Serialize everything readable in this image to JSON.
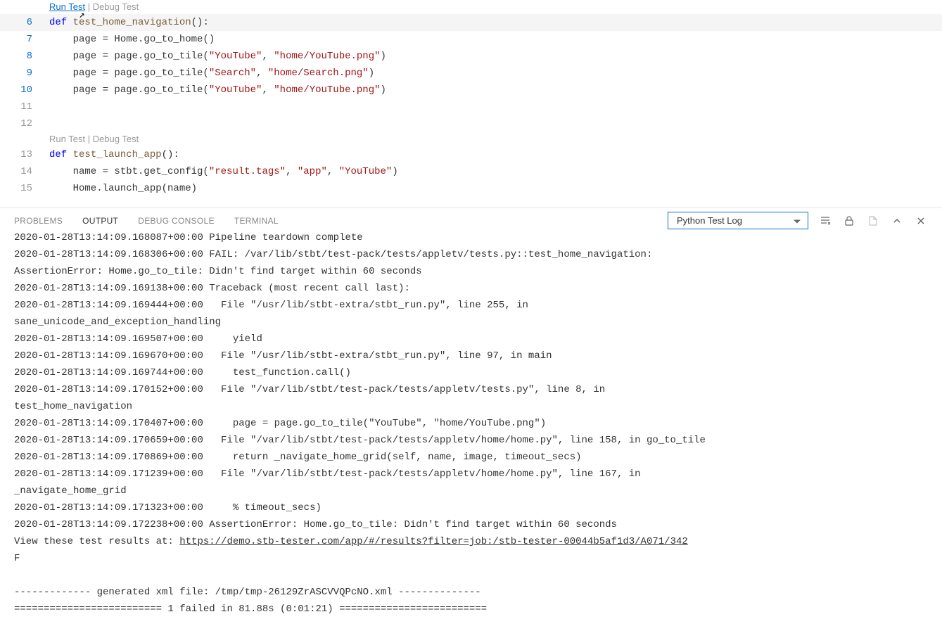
{
  "editor": {
    "codelens1": {
      "run": "Run Test",
      "debug": "Debug Test"
    },
    "codelens2": {
      "run": "Run Test",
      "debug": "Debug Test"
    },
    "lines": [
      {
        "num": "6",
        "active": true,
        "highlighted": true,
        "tokens": [
          {
            "t": "def ",
            "c": "kw"
          },
          {
            "t": "test_home_navigation",
            "c": "fn"
          },
          {
            "t": "():",
            "c": ""
          }
        ]
      },
      {
        "num": "7",
        "active": true,
        "tokens": [
          {
            "t": "    page = Home.go_to_home()",
            "c": ""
          }
        ]
      },
      {
        "num": "8",
        "active": true,
        "tokens": [
          {
            "t": "    page = page.go_to_tile(",
            "c": ""
          },
          {
            "t": "\"YouTube\"",
            "c": "str"
          },
          {
            "t": ", ",
            "c": ""
          },
          {
            "t": "\"home/YouTube.png\"",
            "c": "str"
          },
          {
            "t": ")",
            "c": ""
          }
        ]
      },
      {
        "num": "9",
        "active": true,
        "tokens": [
          {
            "t": "    page = page.go_to_tile(",
            "c": ""
          },
          {
            "t": "\"Search\"",
            "c": "str"
          },
          {
            "t": ", ",
            "c": ""
          },
          {
            "t": "\"home/Search.png\"",
            "c": "str"
          },
          {
            "t": ")",
            "c": ""
          }
        ]
      },
      {
        "num": "10",
        "active": true,
        "tokens": [
          {
            "t": "    page = page.go_to_tile(",
            "c": ""
          },
          {
            "t": "\"YouTube\"",
            "c": "str"
          },
          {
            "t": ", ",
            "c": ""
          },
          {
            "t": "\"home/YouTube.png\"",
            "c": "str"
          },
          {
            "t": ")",
            "c": ""
          }
        ]
      },
      {
        "num": "11",
        "tokens": []
      },
      {
        "num": "12",
        "tokens": []
      },
      {
        "num": "13",
        "tokens": [
          {
            "t": "def ",
            "c": "kw"
          },
          {
            "t": "test_launch_app",
            "c": "fn"
          },
          {
            "t": "():",
            "c": ""
          }
        ]
      },
      {
        "num": "14",
        "tokens": [
          {
            "t": "    name = stbt.get_config(",
            "c": ""
          },
          {
            "t": "\"result.tags\"",
            "c": "str"
          },
          {
            "t": ", ",
            "c": ""
          },
          {
            "t": "\"app\"",
            "c": "str"
          },
          {
            "t": ", ",
            "c": ""
          },
          {
            "t": "\"YouTube\"",
            "c": "str"
          },
          {
            "t": ")",
            "c": ""
          }
        ]
      },
      {
        "num": "15",
        "tokens": [
          {
            "t": "    Home.launch_app(name)",
            "c": ""
          }
        ]
      }
    ]
  },
  "panel": {
    "tabs": {
      "problems": "PROBLEMS",
      "output": "OUTPUT",
      "debug": "DEBUG CONSOLE",
      "terminal": "TERMINAL"
    },
    "select": "Python Test Log",
    "output_lines": [
      "2020-01-28T13:14:09.168087+00:00 Pipeline teardown complete",
      "2020-01-28T13:14:09.168306+00:00 FAIL: /var/lib/stbt/test-pack/tests/appletv/tests.py::test_home_navigation: ",
      "AssertionError: Home.go_to_tile: Didn't find target within 60 seconds",
      "2020-01-28T13:14:09.169138+00:00 Traceback (most recent call last):",
      "2020-01-28T13:14:09.169444+00:00   File \"/usr/lib/stbt-extra/stbt_run.py\", line 255, in ",
      "sane_unicode_and_exception_handling",
      "2020-01-28T13:14:09.169507+00:00     yield",
      "2020-01-28T13:14:09.169670+00:00   File \"/usr/lib/stbt-extra/stbt_run.py\", line 97, in main",
      "2020-01-28T13:14:09.169744+00:00     test_function.call()",
      "2020-01-28T13:14:09.170152+00:00   File \"/var/lib/stbt/test-pack/tests/appletv/tests.py\", line 8, in ",
      "test_home_navigation",
      "2020-01-28T13:14:09.170407+00:00     page = page.go_to_tile(\"YouTube\", \"home/YouTube.png\")",
      "2020-01-28T13:14:09.170659+00:00   File \"/var/lib/stbt/test-pack/tests/appletv/home/home.py\", line 158, in go_to_tile",
      "2020-01-28T13:14:09.170869+00:00     return _navigate_home_grid(self, name, image, timeout_secs)",
      "2020-01-28T13:14:09.171239+00:00   File \"/var/lib/stbt/test-pack/tests/appletv/home/home.py\", line 167, in ",
      "_navigate_home_grid",
      "2020-01-28T13:14:09.171323+00:00     % timeout_secs)",
      "2020-01-28T13:14:09.172238+00:00 AssertionError: Home.go_to_tile: Didn't find target within 60 seconds"
    ],
    "result_prefix": "View these test results at: ",
    "result_link": "https://demo.stb-tester.com/app/#/results?filter=job:/stb-tester-00044b5af1d3/A071/342",
    "f_line": "F",
    "blank": "",
    "xml_line": "------------- generated xml file: /tmp/tmp-26129ZrASCVVQPcNO.xml --------------",
    "summary": "========================= 1 failed in 81.88s (0:01:21) ========================="
  }
}
